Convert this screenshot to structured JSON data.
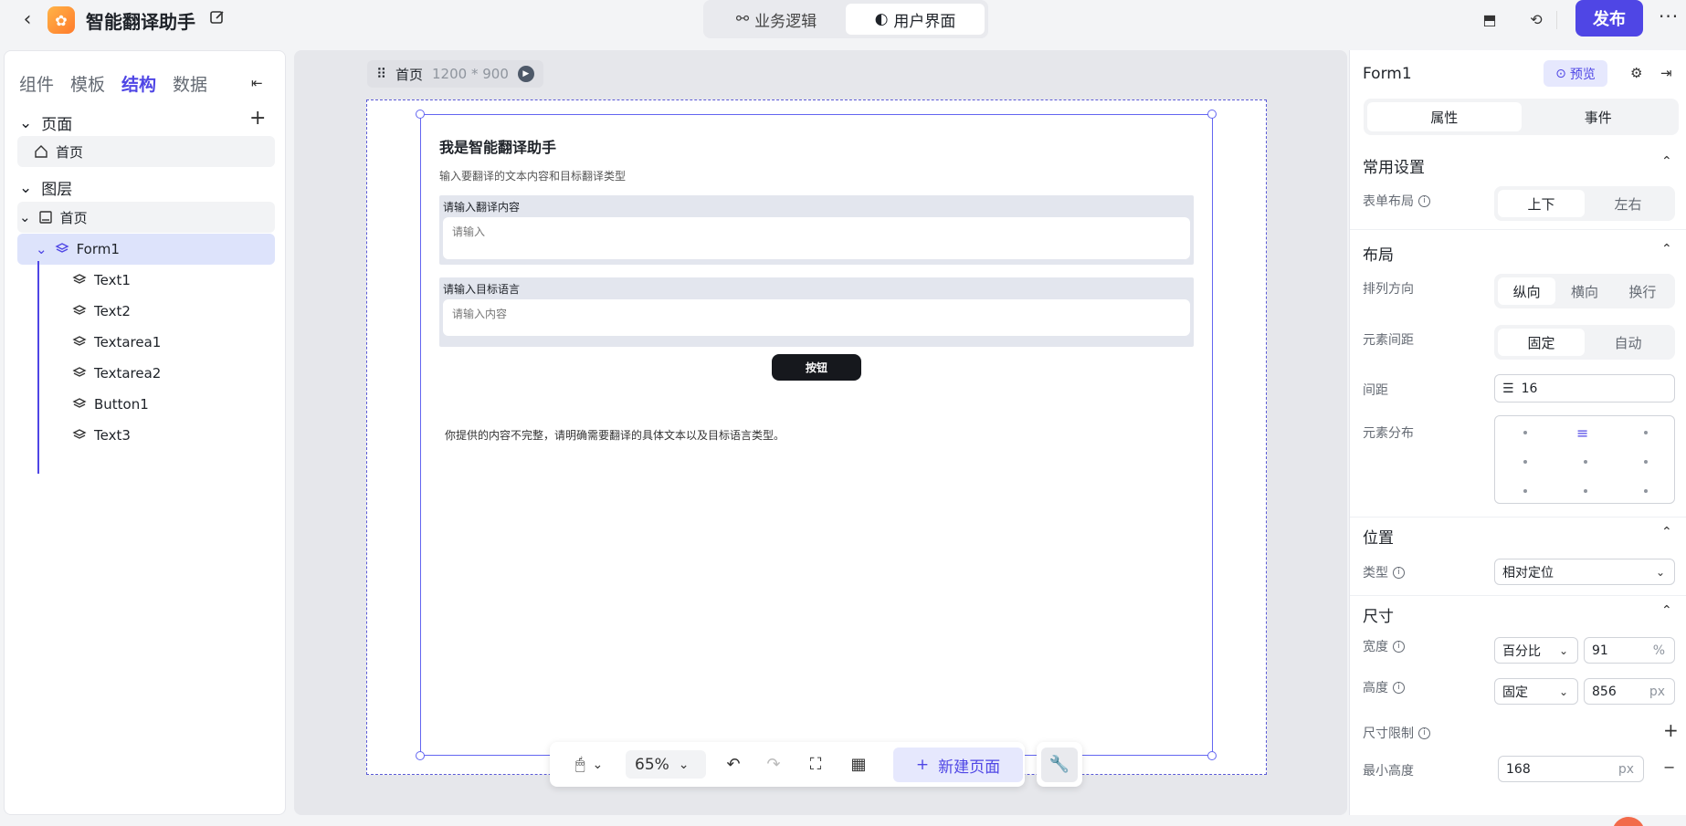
{
  "app": {
    "title": "智能翻译助手"
  },
  "modes": [
    {
      "label": "业务逻辑",
      "active": false
    },
    {
      "label": "用户界面",
      "active": true
    }
  ],
  "header": {
    "publish_label": "发布",
    "more_label": "···"
  },
  "left_panel": {
    "tabs": [
      "组件",
      "模板",
      "结构",
      "数据"
    ],
    "active_tab": "结构",
    "pages_section": "页面",
    "page_item": "首页",
    "layers_section": "图层",
    "layer_root": "首页",
    "layers": [
      "Form1",
      "Text1",
      "Text2",
      "Textarea1",
      "Textarea2",
      "Button1",
      "Text3"
    ]
  },
  "canvas": {
    "page_name": "首页",
    "page_size": "1200 * 900",
    "heading": "我是智能翻译助手",
    "subheading": "输入要翻译的文本内容和目标翻译类型",
    "field1_label": "请输入翻译内容",
    "field1_placeholder": "请输入",
    "field2_label": "请输入目标语言",
    "field2_placeholder": "请输入内容",
    "button_label": "按钮",
    "result_text": "你提供的内容不完整，请明确需要翻译的具体文本以及目标语言类型。"
  },
  "toolbar": {
    "zoom": "65%",
    "new_page_label": "新建页面"
  },
  "right_panel": {
    "title": "Form1",
    "preview_label": "预览",
    "tabs": [
      "属性",
      "事件"
    ],
    "common_section": "常用设置",
    "form_layout_label": "表单布局",
    "form_layout_options": [
      "上下",
      "左右"
    ],
    "layout_section": "布局",
    "direction_label": "排列方向",
    "direction_options": [
      "纵向",
      "横向",
      "换行"
    ],
    "spacing_mode_label": "元素间距",
    "spacing_mode_options": [
      "固定",
      "自动"
    ],
    "gap_label": "间距",
    "gap_value": "16",
    "distribution_label": "元素分布",
    "position_section": "位置",
    "position_type_label": "类型",
    "position_type_value": "相对定位",
    "size_section": "尺寸",
    "width_label": "宽度",
    "width_mode": "百分比",
    "width_value": "91",
    "width_unit": "%",
    "height_label": "高度",
    "height_mode": "固定",
    "height_value": "856",
    "height_unit": "px",
    "size_limit_label": "尺寸限制",
    "min_height_label": "最小高度",
    "min_height_value": "168",
    "min_height_unit": "px"
  },
  "colors": {
    "accent": "#4f46e5",
    "selected_row": "#dde3fb"
  }
}
